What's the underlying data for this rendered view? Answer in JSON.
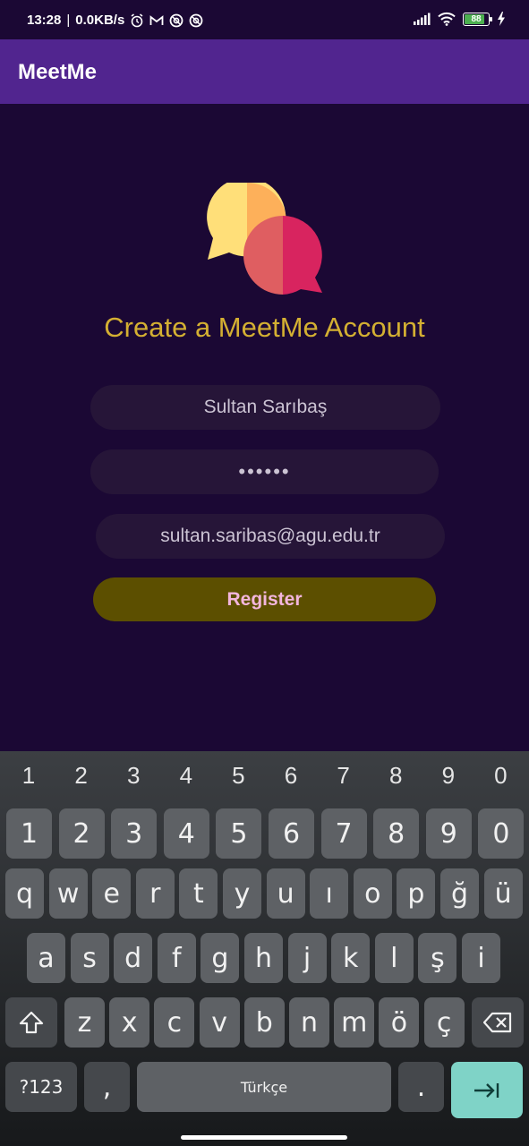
{
  "status_bar": {
    "time": "13:28",
    "net_speed": "0.0KB/s",
    "battery": "88",
    "battery_level": 0.88,
    "icons": [
      "alarm-icon",
      "gmail-icon",
      "app-icon",
      "app-icon",
      "signal-icon",
      "wifi-icon",
      "battery-icon",
      "charging-icon"
    ]
  },
  "app_bar": {
    "title": "MeetMe"
  },
  "main": {
    "headline": "Create a MeetMe Account",
    "name_value": "Sultan Sarıbaş",
    "password_value": "••••••",
    "email_value": "sultan.saribas@agu.edu.tr",
    "register_label": "Register",
    "colors": {
      "background": "#1b0834",
      "app_bar": "#51258f",
      "headline": "#d4b032",
      "field_bg": "#261538",
      "button_bg": "#5c4f00",
      "button_text": "#f3b6dd"
    }
  },
  "keyboard": {
    "hints": [
      "1",
      "2",
      "3",
      "4",
      "5",
      "6",
      "7",
      "8",
      "9",
      "0"
    ],
    "row_numbers": [
      "1",
      "2",
      "3",
      "4",
      "5",
      "6",
      "7",
      "8",
      "9",
      "0"
    ],
    "row_q": [
      "q",
      "w",
      "e",
      "r",
      "t",
      "y",
      "u",
      "ı",
      "o",
      "p",
      "ğ",
      "ü"
    ],
    "row_a": [
      "a",
      "s",
      "d",
      "f",
      "g",
      "h",
      "j",
      "k",
      "l",
      "ş",
      "i"
    ],
    "row_z": [
      "z",
      "x",
      "c",
      "v",
      "b",
      "n",
      "m",
      "ö",
      "ç"
    ],
    "sym_label": "?123",
    "comma_label": ",",
    "space_label": "Türkçe",
    "period_label": ".",
    "shift_icon": "shift-icon",
    "backspace_icon": "backspace-icon",
    "enter_icon": "next-field-icon"
  }
}
